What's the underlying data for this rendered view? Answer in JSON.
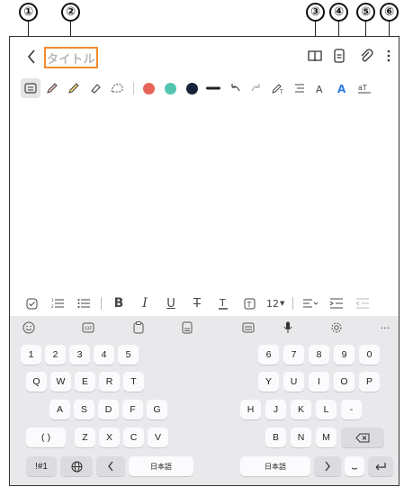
{
  "callouts": [
    "①",
    "②",
    "③",
    "④",
    "⑤",
    "⑥"
  ],
  "header": {
    "title": "タイトル",
    "icons": [
      "back-icon",
      "book-icon",
      "page-icon",
      "attach-icon",
      "more-icon"
    ]
  },
  "pen_colors": [
    "#e8635a",
    "#52c5b0",
    "#16243a"
  ],
  "pen_toolbar_icons": [
    "keyboard-mode",
    "pen",
    "highlighter",
    "eraser",
    "lasso",
    "color-red",
    "color-teal",
    "color-navy",
    "stroke-width",
    "undo",
    "redo",
    "handwriting-to-text",
    "straighten",
    "text-size",
    "ink-style",
    "text-convert"
  ],
  "format_bar": {
    "font_size": "12",
    "items": [
      "checkbox",
      "numbered-list",
      "bullet-list",
      "bold",
      "italic",
      "underline",
      "strikethrough",
      "text-color",
      "highlight",
      "font-size",
      "align",
      "indent",
      "outdent"
    ]
  },
  "keyboard": {
    "row1_left": [
      "1",
      "2",
      "3",
      "4",
      "5"
    ],
    "row1_right": [
      "6",
      "7",
      "8",
      "9",
      "0"
    ],
    "row2_left": [
      "Q",
      "W",
      "E",
      "R",
      "T"
    ],
    "row2_right": [
      "Y",
      "U",
      "I",
      "O",
      "P"
    ],
    "row3_left": [
      "A",
      "S",
      "D",
      "F",
      "G"
    ],
    "row3_right": [
      "H",
      "J",
      "K",
      "L",
      "-"
    ],
    "row4_left": [
      "( )",
      "Z",
      "X",
      "C",
      "V"
    ],
    "row4_right": [
      "B",
      "N",
      "M"
    ],
    "symbol_key": "!#1",
    "lang_key_left": "日本語",
    "lang_key_right": "日本語",
    "kb_tools": [
      "emoji",
      "sticker",
      "clipboard",
      "keyboard-settings-mode",
      "one-hand",
      "voice",
      "settings",
      "more"
    ],
    "more_label": "···"
  }
}
